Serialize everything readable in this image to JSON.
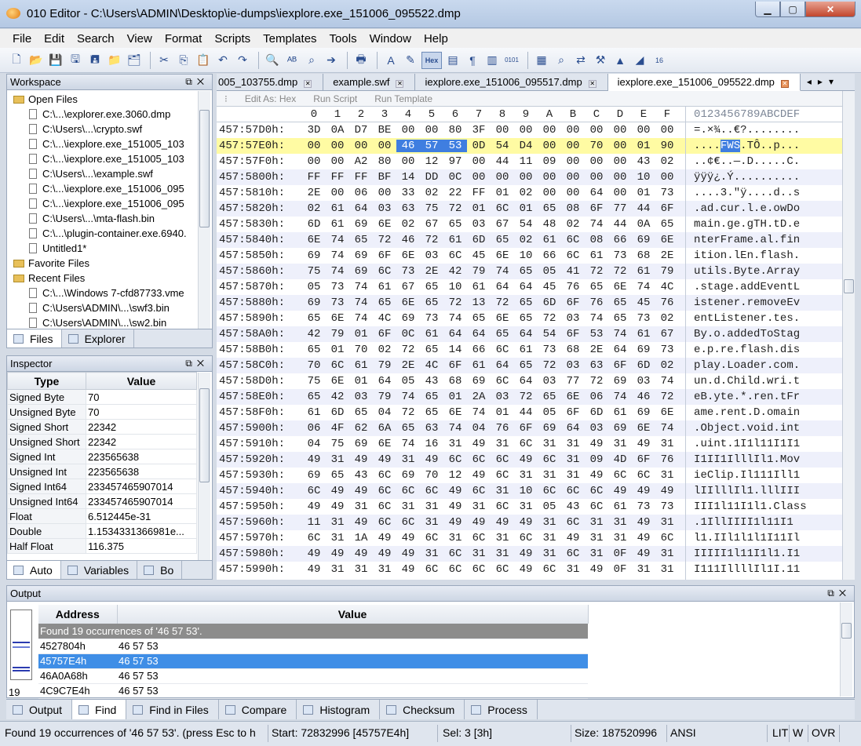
{
  "window": {
    "title": "010 Editor - C:\\Users\\ADMIN\\Desktop\\ie-dumps\\iexplore.exe_151006_095522.dmp"
  },
  "menu": [
    "File",
    "Edit",
    "Search",
    "View",
    "Format",
    "Scripts",
    "Templates",
    "Tools",
    "Window",
    "Help"
  ],
  "workspace": {
    "title": "Workspace",
    "open_files_label": "Open Files",
    "open_files": [
      "C:\\...\\explorer.exe.3060.dmp",
      "C:\\Users\\...\\crypto.swf",
      "C:\\...\\iexplore.exe_151005_103",
      "C:\\...\\iexplore.exe_151005_103",
      "C:\\Users\\...\\example.swf",
      "C:\\...\\iexplore.exe_151006_095",
      "C:\\...\\iexplore.exe_151006_095",
      "C:\\Users\\...\\mta-flash.bin",
      "C:\\...\\plugin-container.exe.6940.",
      "Untitled1*"
    ],
    "favorite_label": "Favorite Files",
    "recent_label": "Recent Files",
    "recent_files": [
      "C:\\...\\Windows 7-cfd87733.vme",
      "C:\\Users\\ADMIN\\...\\swf3.bin",
      "C:\\Users\\ADMIN\\...\\sw2.bin"
    ],
    "tabs": [
      "Files",
      "Explorer"
    ]
  },
  "inspector": {
    "title": "Inspector",
    "headers": [
      "Type",
      "Value"
    ],
    "rows": [
      [
        "Signed Byte",
        "70"
      ],
      [
        "Unsigned Byte",
        "70"
      ],
      [
        "Signed Short",
        "22342"
      ],
      [
        "Unsigned Short",
        "22342"
      ],
      [
        "Signed Int",
        "223565638"
      ],
      [
        "Unsigned Int",
        "223565638"
      ],
      [
        "Signed Int64",
        "233457465907014"
      ],
      [
        "Unsigned Int64",
        "233457465907014"
      ],
      [
        "Float",
        "6.512445e-31"
      ],
      [
        "Double",
        "1.1534331366981e..."
      ],
      [
        "Half Float",
        "116.375"
      ]
    ],
    "tabs": [
      "Auto",
      "Variables",
      "Bo"
    ]
  },
  "file_tabs": [
    {
      "label": "005_103755.dmp",
      "active": false
    },
    {
      "label": "example.swf",
      "active": false
    },
    {
      "label": "iexplore.exe_151006_095517.dmp",
      "active": false
    },
    {
      "label": "iexplore.exe_151006_095522.dmp",
      "active": true
    }
  ],
  "editor_bar": [
    "Edit As: Hex",
    "Run Script",
    "Run Template"
  ],
  "column_header": {
    "hex": [
      "0",
      "1",
      "2",
      "3",
      "4",
      "5",
      "6",
      "7",
      "8",
      "9",
      "A",
      "B",
      "C",
      "D",
      "E",
      "F"
    ],
    "ascii": "0123456789ABCDEF"
  },
  "hex_rows": [
    {
      "addr": "457:57D0h:",
      "bytes": "3D 0A D7 BE 00 00 80 3F 00 00 00 00 00 00 00 00",
      "ascii": "=.×¾..€?........"
    },
    {
      "addr": "457:57E0h:",
      "bytes": "00 00 00 00 46 57 53 0D 54 D4 00 00 70 00 01 90",
      "ascii": "....FWS.TÔ..p..."
    },
    {
      "addr": "457:57F0h:",
      "bytes": "00 00 A2 80 00 12 97 00 44 11 09 00 00 00 43 02",
      "ascii": "..¢€..—.D.....C."
    },
    {
      "addr": "457:5800h:",
      "bytes": "FF FF FF BF 14 DD 0C 00 00 00 00 00 00 00 10 00",
      "ascii": "ÿÿÿ¿.Ý.........."
    },
    {
      "addr": "457:5810h:",
      "bytes": "2E 00 06 00 33 02 22 FF 01 02 00 00 64 00 01 73",
      "ascii": "....3.\"ÿ....d..s"
    },
    {
      "addr": "457:5820h:",
      "bytes": "02 61 64 03 63 75 72 01 6C 01 65 08 6F 77 44 6F",
      "ascii": ".ad.cur.l.e.owDo"
    },
    {
      "addr": "457:5830h:",
      "bytes": "6D 61 69 6E 02 67 65 03 67 54 48 02 74 44 0A 65",
      "ascii": "main.ge.gTH.tD.e"
    },
    {
      "addr": "457:5840h:",
      "bytes": "6E 74 65 72 46 72 61 6D 65 02 61 6C 08 66 69 6E",
      "ascii": "nterFrame.al.fin"
    },
    {
      "addr": "457:5850h:",
      "bytes": "69 74 69 6F 6E 03 6C 45 6E 10 66 6C 61 73 68 2E",
      "ascii": "ition.lEn.flash."
    },
    {
      "addr": "457:5860h:",
      "bytes": "75 74 69 6C 73 2E 42 79 74 65 05 41 72 72 61 79",
      "ascii": "utils.Byte.Array"
    },
    {
      "addr": "457:5870h:",
      "bytes": "05 73 74 61 67 65 10 61 64 64 45 76 65 6E 74 4C",
      "ascii": ".stage.addEventL"
    },
    {
      "addr": "457:5880h:",
      "bytes": "69 73 74 65 6E 65 72 13 72 65 6D 6F 76 65 45 76",
      "ascii": "istener.removeEv"
    },
    {
      "addr": "457:5890h:",
      "bytes": "65 6E 74 4C 69 73 74 65 6E 65 72 03 74 65 73 02",
      "ascii": "entListener.tes."
    },
    {
      "addr": "457:58A0h:",
      "bytes": "42 79 01 6F 0C 61 64 64 65 64 54 6F 53 74 61 67",
      "ascii": "By.o.addedToStag"
    },
    {
      "addr": "457:58B0h:",
      "bytes": "65 01 70 02 72 65 14 66 6C 61 73 68 2E 64 69 73",
      "ascii": "e.p.re.flash.dis"
    },
    {
      "addr": "457:58C0h:",
      "bytes": "70 6C 61 79 2E 4C 6F 61 64 65 72 03 63 6F 6D 02",
      "ascii": "play.Loader.com."
    },
    {
      "addr": "457:58D0h:",
      "bytes": "75 6E 01 64 05 43 68 69 6C 64 03 77 72 69 03 74",
      "ascii": "un.d.Child.wri.t"
    },
    {
      "addr": "457:58E0h:",
      "bytes": "65 42 03 79 74 65 01 2A 03 72 65 6E 06 74 46 72",
      "ascii": "eB.yte.*.ren.tFr"
    },
    {
      "addr": "457:58F0h:",
      "bytes": "61 6D 65 04 72 65 6E 74 01 44 05 6F 6D 61 69 6E",
      "ascii": "ame.rent.D.omain"
    },
    {
      "addr": "457:5900h:",
      "bytes": "06 4F 62 6A 65 63 74 04 76 6F 69 64 03 69 6E 74",
      "ascii": ".Object.void.int"
    },
    {
      "addr": "457:5910h:",
      "bytes": "04 75 69 6E 74 16 31 49 31 6C 31 31 49 31 49 31",
      "ascii": ".uint.1I1l11I1I1"
    },
    {
      "addr": "457:5920h:",
      "bytes": "49 31 49 49 31 49 6C 6C 6C 49 6C 31 09 4D 6F 76",
      "ascii": "I1II1IlllIl1.Mov"
    },
    {
      "addr": "457:5930h:",
      "bytes": "69 65 43 6C 69 70 12 49 6C 31 31 31 49 6C 6C 31",
      "ascii": "ieClip.Il111Ill1"
    },
    {
      "addr": "457:5940h:",
      "bytes": "6C 49 49 6C 6C 6C 49 6C 31 10 6C 6C 6C 49 49 49",
      "ascii": "lIIlllIl1.lllIII"
    },
    {
      "addr": "457:5950h:",
      "bytes": "49 49 31 6C 31 31 49 31 6C 31 05 43 6C 61 73 73",
      "ascii": "III1l11I1l1.Class"
    },
    {
      "addr": "457:5960h:",
      "bytes": "11 31 49 6C 6C 31 49 49 49 49 31 6C 31 31 49 31",
      "ascii": ".1IllIIII1l11I1"
    },
    {
      "addr": "457:5970h:",
      "bytes": "6C 31 1A 49 49 6C 31 6C 31 6C 31 49 31 31 49 6C",
      "ascii": "l1.IIl1l1l1I11Il"
    },
    {
      "addr": "457:5980h:",
      "bytes": "49 49 49 49 49 31 6C 31 31 49 31 6C 31 0F 49 31",
      "ascii": "IIIII1l11I1l1.I1"
    },
    {
      "addr": "457:5990h:",
      "bytes": "49 31 31 31 49 6C 6C 6C 6C 49 6C 31 49 0F 31 31",
      "ascii": "I111IllllIl1I.11"
    }
  ],
  "selected_row": 1,
  "selected_bytes": [
    4,
    5,
    6
  ],
  "output": {
    "title": "Output",
    "headers": [
      "Address",
      "Value"
    ],
    "summary": "Found 19 occurrences of '46 57 53'.",
    "rows": [
      [
        "4527804h",
        "46 57 53"
      ],
      [
        "45757E4h",
        "46 57 53"
      ],
      [
        "46A0A68h",
        "46 57 53"
      ],
      [
        "4C9C7E4h",
        "46 57 53"
      ]
    ],
    "selected_index": 1,
    "count": "19",
    "tabs": [
      "Output",
      "Find",
      "Find in Files",
      "Compare",
      "Histogram",
      "Checksum",
      "Process"
    ]
  },
  "status": {
    "message": "Found 19 occurrences of '46 57 53'. (press Esc to h",
    "start": "Start: 72832996 [45757E4h]",
    "sel": "Sel: 3 [3h]",
    "size": "Size: 187520996",
    "encoding": "ANSI",
    "lit": "LIT",
    "w": "W",
    "ovr": "OVR"
  },
  "colors": {
    "selection": "#3f7ee0",
    "cursor_row": "#fffba3",
    "alt_row": "#eef0fb"
  }
}
